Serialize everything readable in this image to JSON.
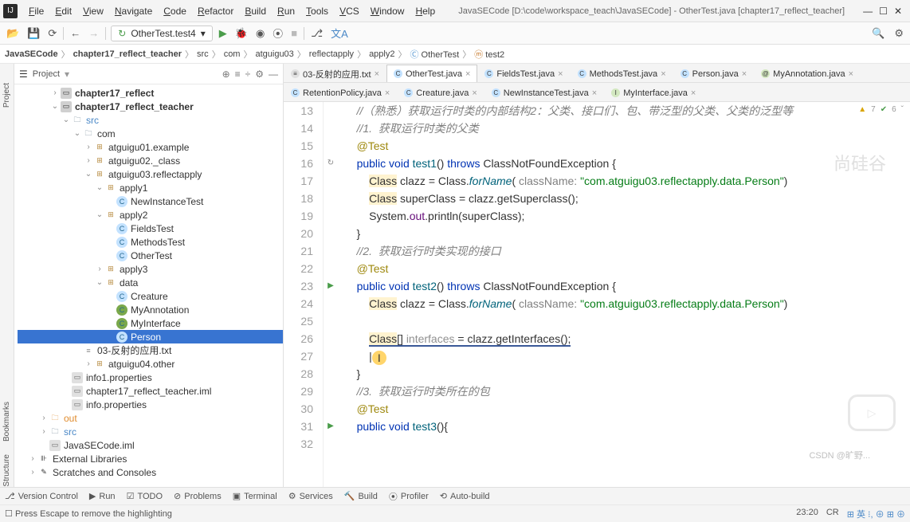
{
  "title": "JavaSECode [D:\\code\\workspace_teach\\JavaSECode] - OtherTest.java [chapter17_reflect_teacher]",
  "menus": [
    "File",
    "Edit",
    "View",
    "Navigate",
    "Code",
    "Refactor",
    "Build",
    "Run",
    "Tools",
    "VCS",
    "Window",
    "Help"
  ],
  "run_config": "OtherTest.test4",
  "breadcrumb": [
    "JavaSECode",
    "chapter17_reflect_teacher",
    "src",
    "com",
    "atguigu03",
    "reflectapply",
    "apply2",
    "OtherTest",
    "test2"
  ],
  "project_label": "Project",
  "left_tabs": [
    "Project",
    "Bookmarks",
    "Structure"
  ],
  "tree": [
    {
      "d": 3,
      "tw": ">",
      "ico": "module",
      "label": "chapter17_reflect",
      "bold": true
    },
    {
      "d": 3,
      "tw": "v",
      "ico": "module",
      "label": "chapter17_reflect_teacher",
      "bold": true
    },
    {
      "d": 4,
      "tw": "v",
      "ico": "folder",
      "label": "src",
      "color": "#4a88c7"
    },
    {
      "d": 5,
      "tw": "v",
      "ico": "folder",
      "label": "com"
    },
    {
      "d": 6,
      "tw": ">",
      "ico": "pkg",
      "label": "atguigu01.example"
    },
    {
      "d": 6,
      "tw": ">",
      "ico": "pkg",
      "label": "atguigu02._class"
    },
    {
      "d": 6,
      "tw": "v",
      "ico": "pkg",
      "label": "atguigu03.reflectapply"
    },
    {
      "d": 7,
      "tw": "v",
      "ico": "pkg",
      "label": "apply1"
    },
    {
      "d": 8,
      "tw": "",
      "ico": "class",
      "label": "NewInstanceTest"
    },
    {
      "d": 7,
      "tw": "v",
      "ico": "pkg",
      "label": "apply2"
    },
    {
      "d": 8,
      "tw": "",
      "ico": "class",
      "label": "FieldsTest"
    },
    {
      "d": 8,
      "tw": "",
      "ico": "class",
      "label": "MethodsTest"
    },
    {
      "d": 8,
      "tw": "",
      "ico": "class",
      "label": "OtherTest"
    },
    {
      "d": 7,
      "tw": ">",
      "ico": "pkg",
      "label": "apply3"
    },
    {
      "d": 7,
      "tw": "v",
      "ico": "pkg",
      "label": "data"
    },
    {
      "d": 8,
      "tw": "",
      "ico": "class",
      "label": "Creature"
    },
    {
      "d": 8,
      "tw": "",
      "ico": "class",
      "label": "MyAnnotation",
      "iclr": "#7aa84b"
    },
    {
      "d": 8,
      "tw": "",
      "ico": "class",
      "label": "MyInterface",
      "iclr": "#7aa84b"
    },
    {
      "d": 8,
      "tw": "",
      "ico": "class",
      "label": "Person",
      "selected": true
    },
    {
      "d": 5,
      "tw": "",
      "ico": "txt",
      "label": "03-反射的应用.txt"
    },
    {
      "d": 6,
      "tw": ">",
      "ico": "pkg",
      "label": "atguigu04.other"
    },
    {
      "d": 4,
      "tw": "",
      "ico": "file",
      "label": "info1.properties"
    },
    {
      "d": 4,
      "tw": "",
      "ico": "file",
      "label": "chapter17_reflect_teacher.iml"
    },
    {
      "d": 4,
      "tw": "",
      "ico": "file",
      "label": "info.properties"
    },
    {
      "d": 2,
      "tw": ">",
      "ico": "out",
      "label": "out",
      "color": "#e08c2e"
    },
    {
      "d": 2,
      "tw": ">",
      "ico": "folder",
      "label": "src",
      "color": "#4a88c7"
    },
    {
      "d": 2,
      "tw": "",
      "ico": "file",
      "label": "JavaSECode.iml"
    },
    {
      "d": 1,
      "tw": ">",
      "ico": "lib",
      "label": "External Libraries"
    },
    {
      "d": 1,
      "tw": ">",
      "ico": "scratch",
      "label": "Scratches and Consoles"
    }
  ],
  "tabs_row1": [
    {
      "ico": "txt",
      "label": "03-反射的应用.txt"
    },
    {
      "ico": "class",
      "label": "OtherTest.java",
      "active": true
    },
    {
      "ico": "class",
      "label": "FieldsTest.java"
    },
    {
      "ico": "class",
      "label": "MethodsTest.java"
    },
    {
      "ico": "class",
      "label": "Person.java"
    },
    {
      "ico": "anno",
      "label": "MyAnnotation.java"
    }
  ],
  "tabs_row2": [
    {
      "ico": "class",
      "label": "RetentionPolicy.java"
    },
    {
      "ico": "class",
      "label": "Creature.java"
    },
    {
      "ico": "class",
      "label": "NewInstanceTest.java"
    },
    {
      "ico": "iface",
      "label": "MyInterface.java"
    }
  ],
  "inspector": {
    "warn": "7",
    "ok": "6"
  },
  "code_first_line": 13,
  "code": [
    {
      "n": 13,
      "html": "    <span class='cm-comment'>//（熟悉）获取运行时类的内部结构2：父类、接口们、包、带泛型的父类、父类的泛型等</span>"
    },
    {
      "n": 14,
      "html": "    <span class='cm-comment'>//1.  获取运行时类的父类</span>"
    },
    {
      "n": 15,
      "html": "    <span class='cm-anno'>@Test</span>"
    },
    {
      "n": 16,
      "gi": "↻",
      "html": "    <span class='cm-kw'>public</span> <span class='cm-kw'>void</span> <span class='cm-method'>test1</span>() <span class='cm-kw'>throws</span> ClassNotFoundException {"
    },
    {
      "n": 17,
      "html": "        <span class='hl-warn'>Class</span> clazz = Class.<span class='cm-static'>forName</span>( <span class='cm-param'>className:</span> <span class='cm-str'>\"com.atguigu03.reflectapply.data.Person\"</span>)"
    },
    {
      "n": 18,
      "html": "        <span class='hl-warn'>Class</span> superClass = clazz.getSuperclass();"
    },
    {
      "n": 19,
      "html": "        System.<span class='cm-var'>out</span>.println(superClass);"
    },
    {
      "n": 20,
      "html": "    }"
    },
    {
      "n": 21,
      "html": "    <span class='cm-comment'>//2.  获取运行时类实现的接口</span>"
    },
    {
      "n": 22,
      "html": "    <span class='cm-anno'>@Test</span>"
    },
    {
      "n": 23,
      "gi": "▶",
      "html": "    <span class='cm-kw'>public</span> <span class='cm-kw'>void</span> <span class='cm-method'>test2</span>() <span class='cm-kw'>throws</span> ClassNotFoundException {"
    },
    {
      "n": 24,
      "html": "        <span class='hl-warn'>Class</span> clazz = Class.<span class='cm-static'>forName</span>( <span class='cm-param'>className:</span> <span class='cm-str'>\"com.atguigu03.reflectapply.data.Person\"</span>)"
    },
    {
      "n": 25,
      "html": ""
    },
    {
      "n": 26,
      "html": "        <span class='underline-blue'><span class='hl-warn'>Class</span>[] <span class='cm-unused'>interfaces</span> = clazz.getInterfaces();</span>"
    },
    {
      "n": 27,
      "html": "        |<span class='cursor-mark'>I</span>"
    },
    {
      "n": 28,
      "html": "    }"
    },
    {
      "n": 29,
      "html": "    <span class='cm-comment'>//3.  获取运行时类所在的包</span>"
    },
    {
      "n": 30,
      "html": "    <span class='cm-anno'>@Test</span>"
    },
    {
      "n": 31,
      "gi": "▶",
      "html": "    <span class='cm-kw'>public</span> <span class='cm-kw'>void</span> <span class='cm-method'>test3</span>(){"
    },
    {
      "n": 32,
      "html": ""
    }
  ],
  "bottom_tools": [
    "Version Control",
    "Run",
    "TODO",
    "Problems",
    "Terminal",
    "Services",
    "Build",
    "Profiler",
    "Auto-build"
  ],
  "bottom_icons": [
    "⎇",
    "▶",
    "☑",
    "⊘",
    "▣",
    "⚙",
    "🔨",
    "⦿",
    "⟲"
  ],
  "status_msg": "Press Escape to remove the highlighting",
  "status_right": {
    "pos": "23:20",
    "enc": "CR"
  },
  "watermark": "尚硅谷",
  "csdn": "CSDN @旷野..."
}
